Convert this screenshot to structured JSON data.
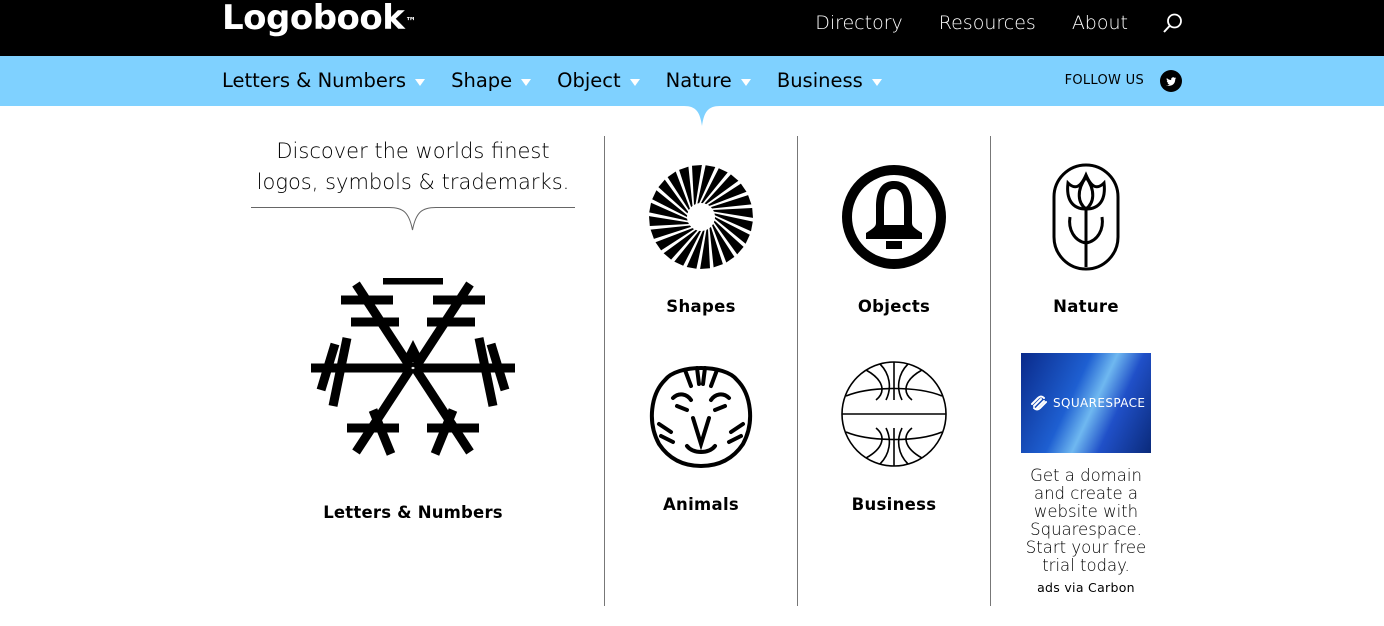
{
  "header": {
    "logo": "Logobook",
    "trademark": "™",
    "nav": [
      "Directory",
      "Resources",
      "About"
    ],
    "search_icon": "search-icon"
  },
  "categories": {
    "items": [
      "Letters & Numbers",
      "Shape",
      "Object",
      "Nature",
      "Business"
    ],
    "follow_label": "FOLLOW US",
    "social_icon": "twitter-icon",
    "bar_color": "#7fd1ff"
  },
  "intro": {
    "line1": "Discover the worlds finest",
    "line2": "logos, symbols & trademarks."
  },
  "hero": {
    "label": "Letters & Numbers",
    "icon": "snowflake-logo-icon"
  },
  "tiles": [
    {
      "label": "Shapes",
      "icon": "sunburst-logo-icon"
    },
    {
      "label": "Objects",
      "icon": "bell-logo-icon"
    },
    {
      "label": "Nature",
      "icon": "tulip-logo-icon"
    },
    {
      "label": "Animals",
      "icon": "tiger-logo-icon"
    },
    {
      "label": "Business",
      "icon": "globe-logo-icon"
    }
  ],
  "ad": {
    "brand": "SQUARESPACE",
    "text": "Get a domain and create a website with Squarespace. Start your free trial today.",
    "credit": "ads via Carbon"
  }
}
